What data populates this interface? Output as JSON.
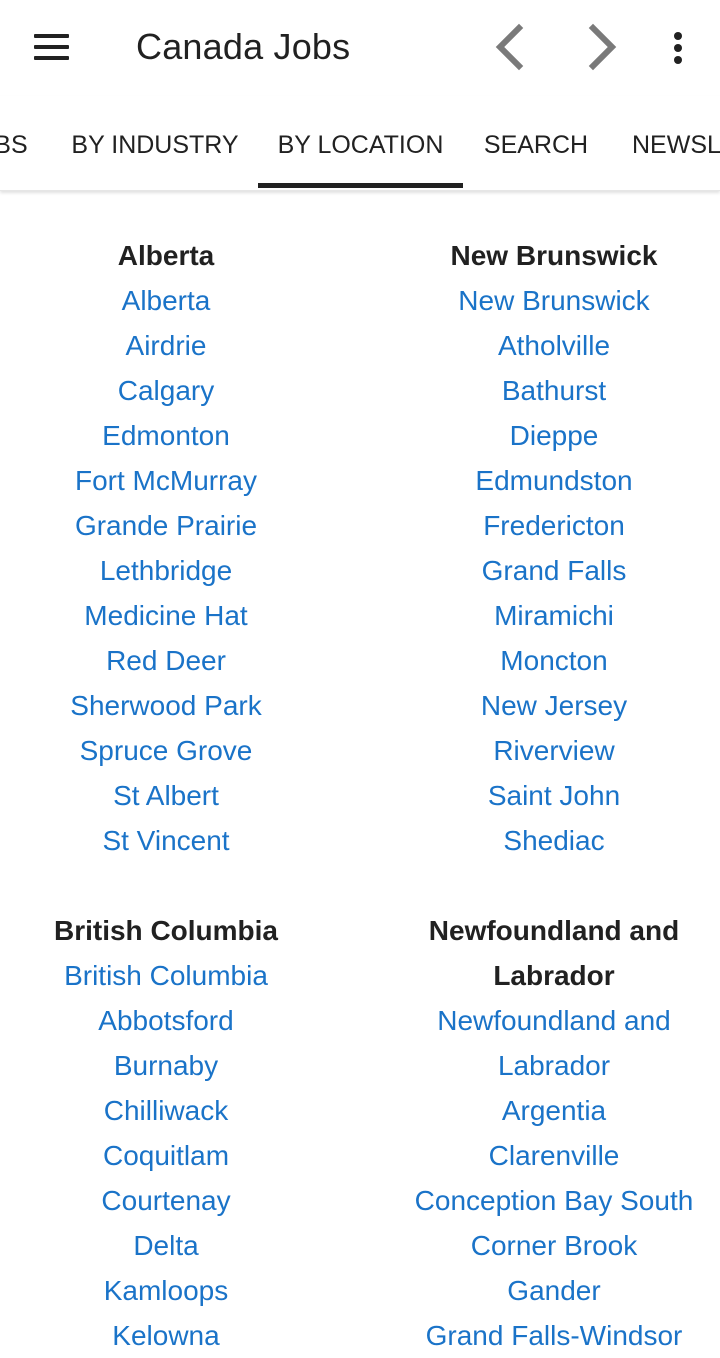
{
  "toolbar": {
    "title": "Canada Jobs",
    "menu_icon": "hamburger-menu-icon",
    "back_icon": "chevron-left-icon",
    "forward_icon": "chevron-right-icon",
    "more_icon": "more-vertical-icon"
  },
  "tabs": [
    {
      "label": "JOBS"
    },
    {
      "label": "BY INDUSTRY"
    },
    {
      "label": "BY LOCATION",
      "selected": true
    },
    {
      "label": "SEARCH"
    },
    {
      "label": "NEWSLETTER"
    }
  ],
  "colors": {
    "link": "#1a73c8",
    "text": "#212121",
    "indicator": "#212121"
  },
  "regions": {
    "alberta": {
      "title": "Alberta",
      "cities": [
        "Alberta",
        "Airdrie",
        "Calgary",
        "Edmonton",
        "Fort McMurray",
        "Grande Prairie",
        "Lethbridge",
        "Medicine Hat",
        "Red Deer",
        "Sherwood Park",
        "Spruce Grove",
        "St Albert",
        "St Vincent"
      ]
    },
    "new_brunswick": {
      "title": "New Brunswick",
      "cities": [
        "New Brunswick",
        "Atholville",
        "Bathurst",
        "Dieppe",
        "Edmundston",
        "Fredericton",
        "Grand Falls",
        "Miramichi",
        "Moncton",
        "New Jersey",
        "Riverview",
        "Saint John",
        "Shediac"
      ]
    },
    "british_columbia": {
      "title": "British Columbia",
      "cities": [
        "British Columbia",
        "Abbotsford",
        "Burnaby",
        "Chilliwack",
        "Coquitlam",
        "Courtenay",
        "Delta",
        "Kamloops",
        "Kelowna"
      ]
    },
    "newfoundland": {
      "title_line1": "Newfoundland and",
      "title_line2": "Labrador",
      "first_city_line1": "Newfoundland and",
      "first_city_line2": "Labrador",
      "cities": [
        "Argentia",
        "Clarenville",
        "Conception Bay South",
        "Corner Brook",
        "Gander",
        "Grand Falls-Windsor"
      ]
    }
  }
}
